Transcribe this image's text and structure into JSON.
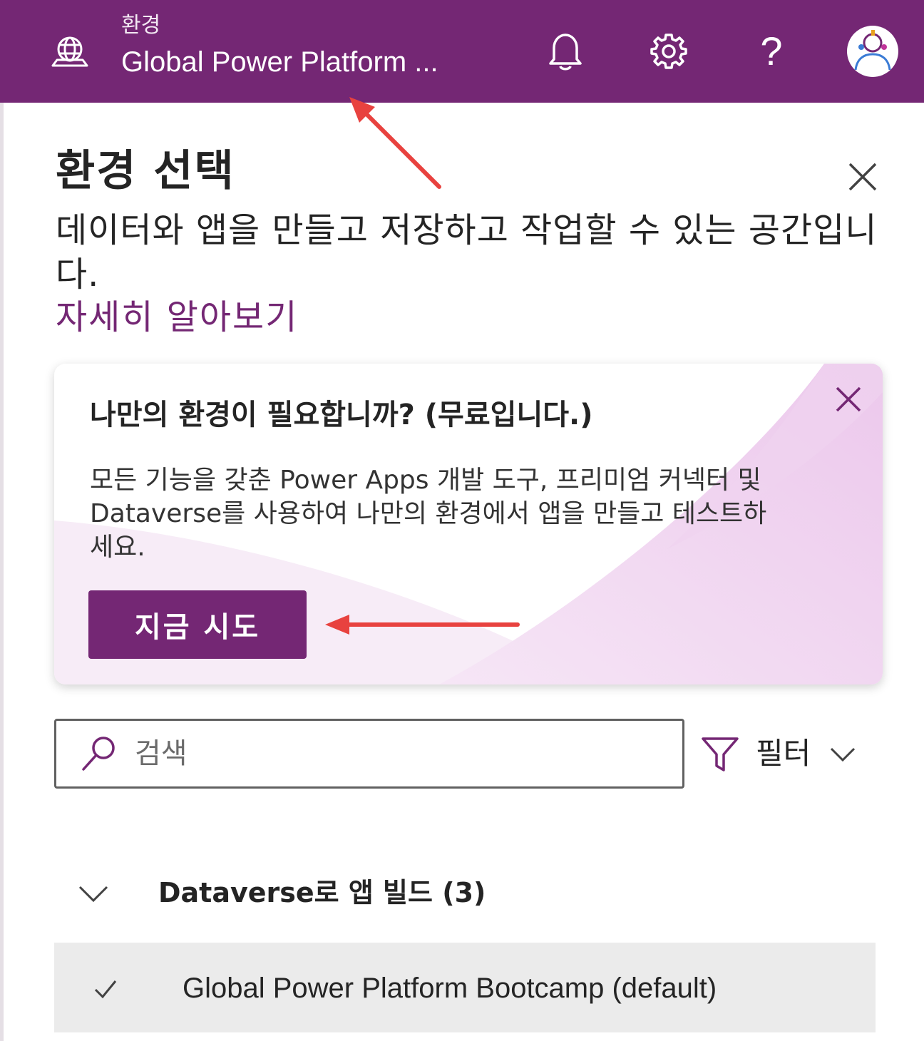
{
  "header": {
    "caption": "환경",
    "environment_name": "Global Power Platform ...",
    "help_glyph": "?",
    "icons": [
      "globe-icon",
      "bell-icon",
      "gear-icon",
      "help-icon",
      "avatar"
    ],
    "color": "#742774"
  },
  "panel": {
    "title": "환경 선택",
    "description": "데이터와 앱을 만들고 저장하고 작업할 수 있는 공간입니다.",
    "learn_more": "자세히 알아보기"
  },
  "promo": {
    "title": "나만의 환경이 필요합니까? (무료입니다.)",
    "body": "모든 기능을 갖춘 Power Apps 개발 도구, 프리미엄 커넥터 및 Dataverse를 사용하여 나만의 환경에서 앱을 만들고 테스트하세요.",
    "button": "지금 시도",
    "accent": "#f0d3ef"
  },
  "search": {
    "placeholder": "검색",
    "value": ""
  },
  "filter": {
    "label": "필터"
  },
  "group": {
    "label": "Dataverse로 앱 빌드 (3)",
    "expanded": true
  },
  "environments": [
    {
      "name": "Global Power Platform Bootcamp (default)",
      "selected": true
    }
  ],
  "annotation_color": "#e8423f"
}
